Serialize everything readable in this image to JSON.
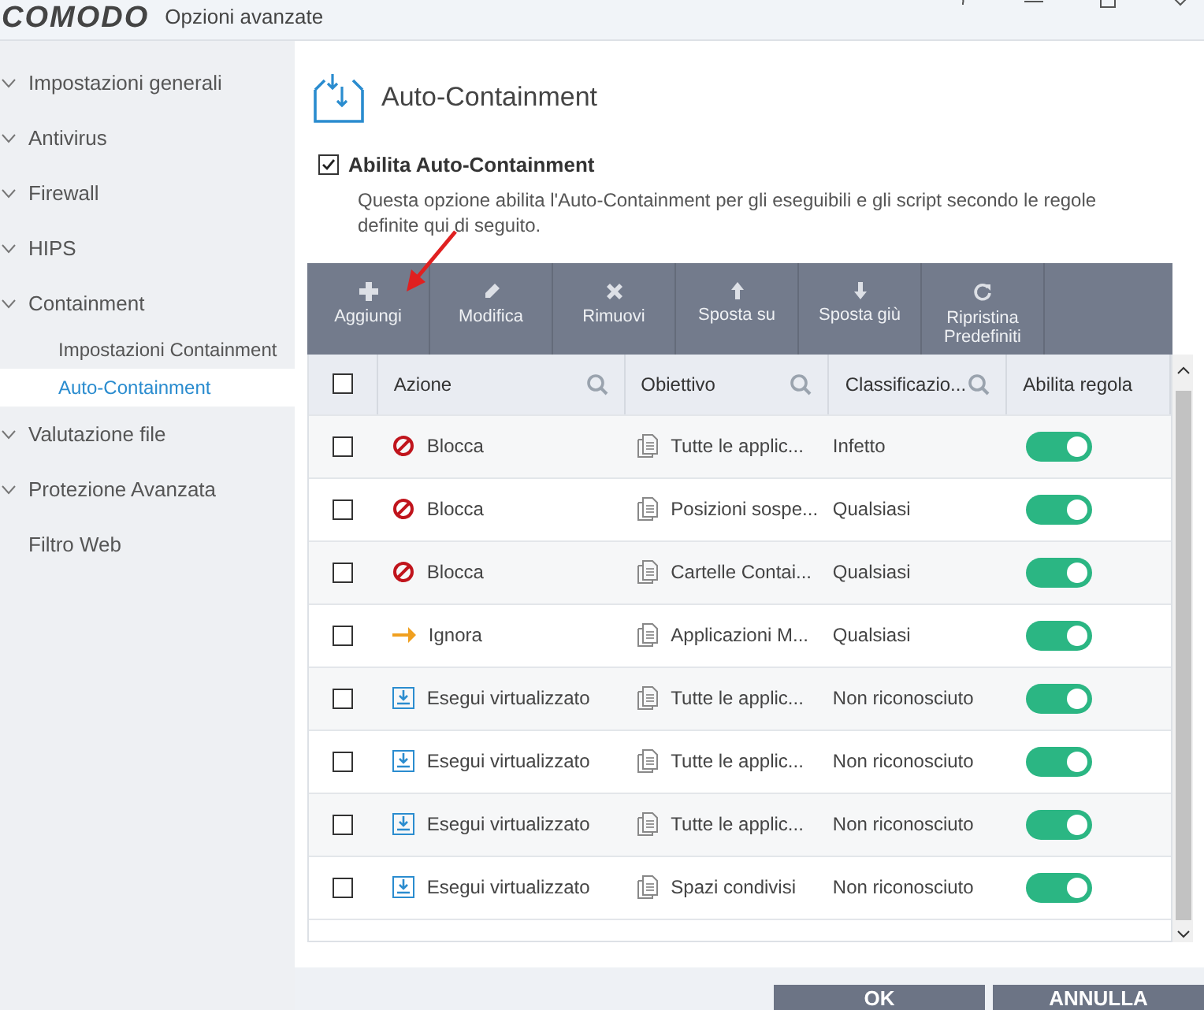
{
  "window": {
    "logo": "COMODO",
    "title": "Opzioni avanzate"
  },
  "sidebar": {
    "items": [
      {
        "label": "Impostazioni generali",
        "kind": "group",
        "selected": false
      },
      {
        "label": "Antivirus",
        "kind": "group",
        "selected": false
      },
      {
        "label": "Firewall",
        "kind": "group",
        "selected": false
      },
      {
        "label": "HIPS",
        "kind": "group",
        "selected": false
      },
      {
        "label": "Containment",
        "kind": "group",
        "selected": false,
        "children": [
          {
            "label": "Impostazioni Containment",
            "selected": false
          },
          {
            "label": "Auto-Containment",
            "selected": true
          }
        ]
      },
      {
        "label": "Valutazione file",
        "kind": "group",
        "selected": false
      },
      {
        "label": "Protezione Avanzata",
        "kind": "group",
        "selected": false
      },
      {
        "label": "Filtro Web",
        "kind": "item",
        "selected": false
      }
    ]
  },
  "page": {
    "title": "Auto-Containment",
    "enable": {
      "label": "Abilita Auto-Containment",
      "checked": true
    },
    "description": "Questa opzione abilita l'Auto-Containment per gli eseguibili e gli script secondo le regole definite qui di seguito."
  },
  "toolbar": [
    {
      "label": "Aggiungi",
      "kind": "plus"
    },
    {
      "label": "Modifica",
      "kind": "pencil"
    },
    {
      "label": "Rimuovi",
      "kind": "x"
    },
    {
      "label": "Sposta su",
      "kind": "up"
    },
    {
      "label": "Sposta giù",
      "kind": "down"
    },
    {
      "label": "Ripristina Predefiniti",
      "kind": "reset"
    }
  ],
  "table": {
    "select_all": {
      "checked": false
    },
    "columns": [
      "Azione",
      "Obiettivo",
      "Classificazio...",
      "Abilita regola"
    ],
    "rows": [
      {
        "checked": false,
        "kind": "block",
        "action": "Blocca",
        "target": "Tutte le applic...",
        "rating": "Infetto",
        "on": true
      },
      {
        "checked": false,
        "kind": "block",
        "action": "Blocca",
        "target": "Posizioni sospe...",
        "rating": "Qualsiasi",
        "on": true
      },
      {
        "checked": false,
        "kind": "block",
        "action": "Blocca",
        "target": "Cartelle Contai...",
        "rating": "Qualsiasi",
        "on": true
      },
      {
        "checked": false,
        "kind": "ignore",
        "action": "Ignora",
        "target": "Applicazioni M...",
        "rating": "Qualsiasi",
        "on": true
      },
      {
        "checked": false,
        "kind": "virtualize",
        "action": "Esegui virtualizzato",
        "target": "Tutte le applic...",
        "rating": "Non riconosciuto",
        "on": true
      },
      {
        "checked": false,
        "kind": "virtualize",
        "action": "Esegui virtualizzato",
        "target": "Tutte le applic...",
        "rating": "Non riconosciuto",
        "on": true
      },
      {
        "checked": false,
        "kind": "virtualize",
        "action": "Esegui virtualizzato",
        "target": "Tutte le applic...",
        "rating": "Non riconosciuto",
        "on": true
      },
      {
        "checked": false,
        "kind": "virtualize",
        "action": "Esegui virtualizzato",
        "target": "Spazi condivisi",
        "rating": "Non riconosciuto",
        "on": true
      }
    ]
  },
  "buttons": [
    "OK",
    "ANNULLA"
  ]
}
